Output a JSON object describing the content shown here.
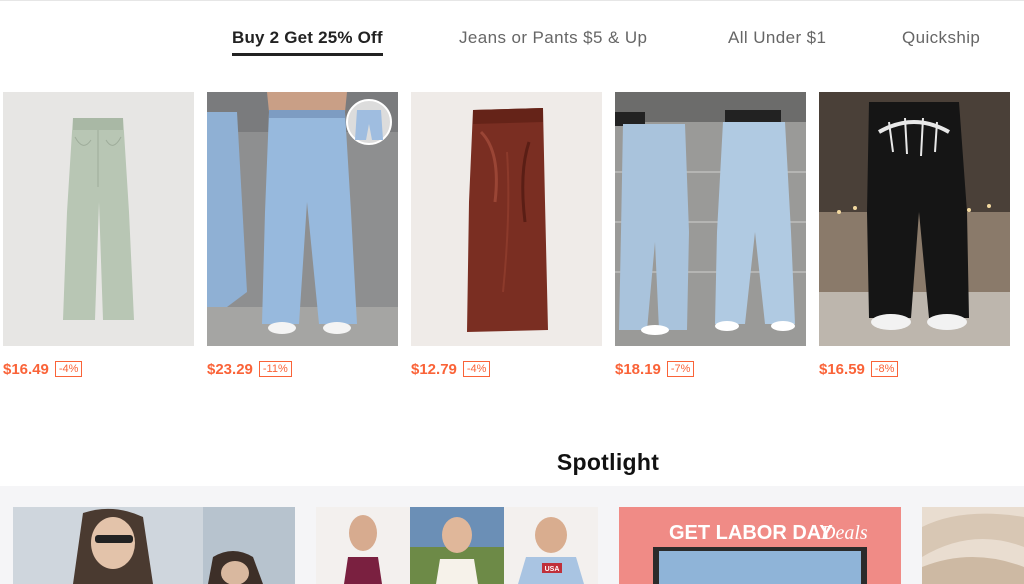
{
  "tabs": [
    {
      "label": "Buy 2 Get 25% Off",
      "active": true
    },
    {
      "label": "Jeans or Pants $5 & Up",
      "active": false
    },
    {
      "label": "All Under $1",
      "active": false
    },
    {
      "label": "Quickship",
      "active": false
    }
  ],
  "products": [
    {
      "name": "sage-wide-leg-pants",
      "price": "$16.49",
      "discount": "-4%"
    },
    {
      "name": "light-wash-baggy-jeans",
      "price": "$23.29",
      "discount": "-11%"
    },
    {
      "name": "brown-leather-midi-skirt",
      "price": "$12.79",
      "discount": "-4%"
    },
    {
      "name": "light-blue-wide-jeans",
      "price": "$18.19",
      "discount": "-7%"
    },
    {
      "name": "black-graphic-sweatpants",
      "price": "$16.59",
      "discount": "-8%"
    }
  ],
  "spotlight": {
    "title": "Spotlight",
    "cards": [
      {
        "name": "model-street-style"
      },
      {
        "name": "tops-collage",
        "shirt_text": "USA"
      },
      {
        "name": "labor-day-deals",
        "banner_text": "GET LABOR DAY",
        "banner_script": "Deals"
      },
      {
        "name": "beige-fabric"
      }
    ]
  },
  "colors": {
    "accent": "#fa6338",
    "active_tab": "#222222",
    "inactive_tab": "#666666"
  }
}
